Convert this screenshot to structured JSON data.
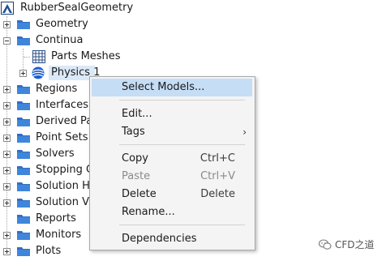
{
  "tree": {
    "root": {
      "label": "RubberSealGeometry",
      "icon": "simulation-root-icon"
    },
    "items": [
      {
        "label": "Geometry",
        "expanded": false
      },
      {
        "label": "Continua",
        "expanded": true
      },
      {
        "label": "Parts Meshes",
        "icon": "grid-icon"
      },
      {
        "label": "Physics 1",
        "icon": "physics-sphere-icon",
        "selected": true
      },
      {
        "label": "Regions",
        "expanded": false
      },
      {
        "label": "Interfaces",
        "expanded": false
      },
      {
        "label": "Derived Pa",
        "expanded": false
      },
      {
        "label": "Point Sets",
        "expanded": false
      },
      {
        "label": "Solvers",
        "expanded": false
      },
      {
        "label": "Stopping C",
        "expanded": false
      },
      {
        "label": "Solution H",
        "expanded": false
      },
      {
        "label": "Solution Vi",
        "expanded": false
      },
      {
        "label": "Reports",
        "expanded": false
      },
      {
        "label": "Monitors",
        "expanded": false
      },
      {
        "label": "Plots",
        "expanded": false
      }
    ]
  },
  "context_menu": {
    "items": [
      {
        "label": "Select Models...",
        "shortcut": "",
        "highlighted": true
      },
      {
        "label": "Edit...",
        "shortcut": ""
      },
      {
        "label": "Tags",
        "shortcut": "",
        "submenu": true
      },
      {
        "label": "Copy",
        "shortcut": "Ctrl+C"
      },
      {
        "label": "Paste",
        "shortcut": "Ctrl+V",
        "disabled": true
      },
      {
        "label": "Delete",
        "shortcut": "Delete"
      },
      {
        "label": "Rename...",
        "shortcut": ""
      },
      {
        "label": "Dependencies",
        "shortcut": ""
      }
    ],
    "submenu_arrow": "›"
  },
  "watermark": {
    "text": "CFD之道",
    "icon": "wechat-icon"
  },
  "colors": {
    "folder": "#2f6fc6",
    "selection": "#c6ddf6",
    "menu_bg": "#f4f4f4"
  }
}
